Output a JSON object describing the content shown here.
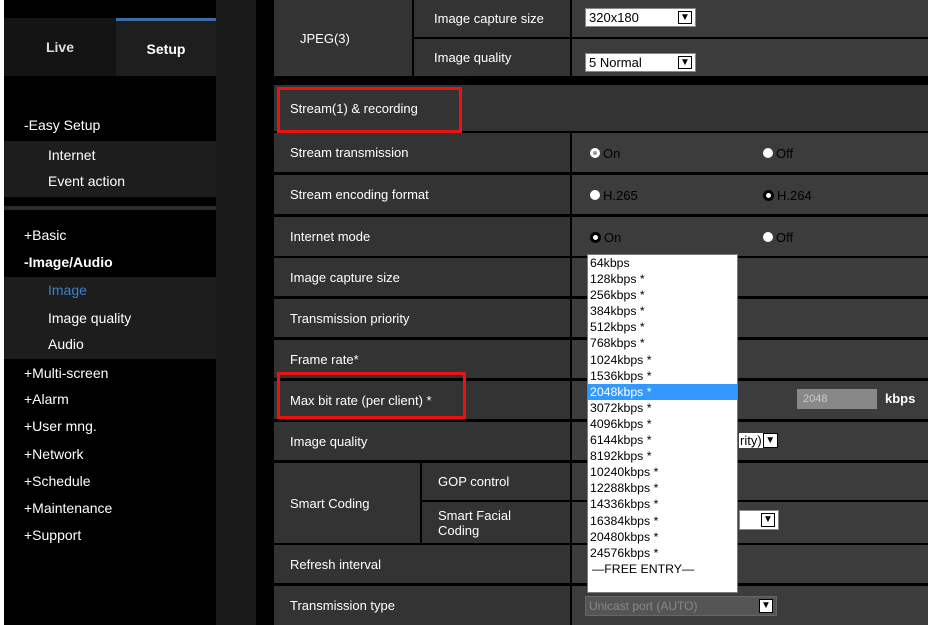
{
  "sidebar": {
    "tabs": {
      "live": "Live",
      "setup": "Setup"
    },
    "easy_setup": "-Easy Setup",
    "internet": "Internet",
    "event_action": "Event action",
    "basic": "+Basic",
    "image_audio": "-Image/Audio",
    "image": "Image",
    "image_quality": "Image quality",
    "audio": "Audio",
    "multi_screen": "+Multi-screen",
    "alarm": "+Alarm",
    "user_mng": "+User mng.",
    "network": "+Network",
    "schedule": "+Schedule",
    "maintenance": "+Maintenance",
    "support": "+Support"
  },
  "jpeg3": {
    "label": "JPEG(3)",
    "capture_size_label": "Image capture size",
    "capture_size_value": "320x180",
    "quality_label": "Image quality",
    "quality_value": "5 Normal"
  },
  "stream": {
    "header": "Stream(1) & recording",
    "transmission_label": "Stream transmission",
    "transmission_on": "On",
    "transmission_off": "Off",
    "encoding_label": "Stream encoding format",
    "h265": "H.265",
    "h264": "H.264",
    "internet_mode_label": "Internet mode",
    "internet_on": "On",
    "internet_off": "Off",
    "capture_size_label": "Image capture size",
    "priority_label": "Transmission priority",
    "frame_rate_label": "Frame rate*",
    "max_bit_rate_label": "Max bit rate (per client) *",
    "max_bit_rate_input": "2048",
    "kbps": "kbps",
    "image_quality_label": "Image quality",
    "image_quality_partial": "rity)",
    "smart_coding_label": "Smart Coding",
    "gop_control": "GOP control",
    "smart_facial_coding_1": "Smart Facial",
    "smart_facial_coding_2": "Coding",
    "refresh_interval_label": "Refresh interval",
    "transmission_type_label": "Transmission type",
    "transmission_type_value": "Unicast port (AUTO)"
  },
  "dropdown": {
    "options": [
      "64kbps",
      "128kbps *",
      "256kbps *",
      "384kbps *",
      "512kbps *",
      "768kbps *",
      "1024kbps *",
      "1536kbps *",
      "2048kbps *",
      "3072kbps *",
      "4096kbps *",
      "6144kbps *",
      "8192kbps *",
      "10240kbps *",
      "12288kbps *",
      "14336kbps *",
      "16384kbps *",
      "20480kbps *",
      "24576kbps *",
      "—FREE ENTRY—"
    ],
    "selected": "2048kbps *"
  },
  "colors": {
    "accent": "#3399ff",
    "highlight": "#e11111",
    "active_menu": "#3a7fd0"
  }
}
